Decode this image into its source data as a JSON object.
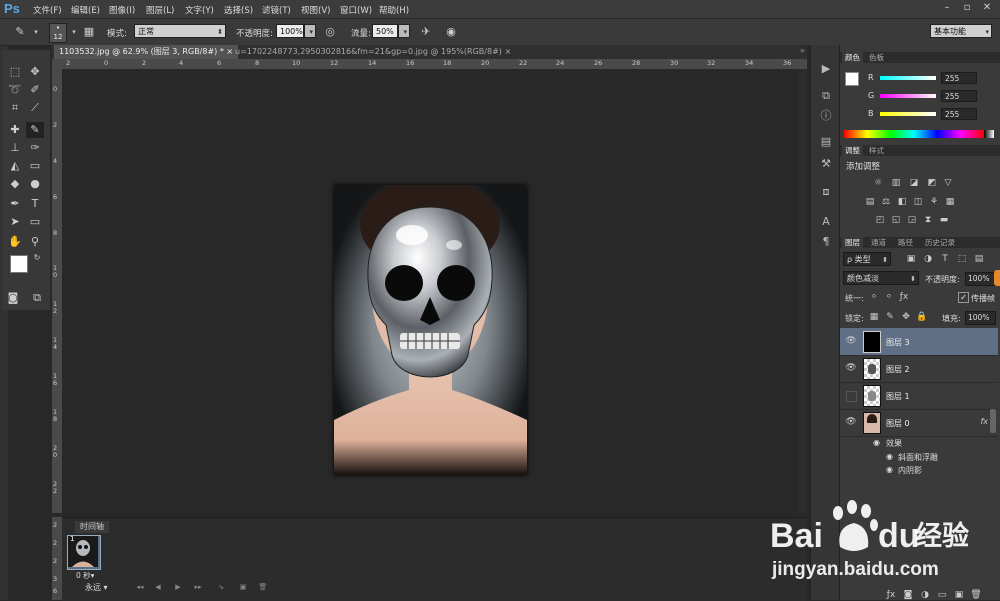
{
  "app": {
    "logo": "Ps"
  },
  "menu": [
    "文件(F)",
    "编辑(E)",
    "图像(I)",
    "图层(L)",
    "文字(Y)",
    "选择(S)",
    "滤镜(T)",
    "视图(V)",
    "窗口(W)",
    "帮助(H)"
  ],
  "options": {
    "brush_size": "12",
    "mode_label": "模式:",
    "mode_value": "正常",
    "opacity_label": "不透明度:",
    "opacity_value": "100%",
    "flow_label": "流量:",
    "flow_value": "50%",
    "workspace": "基本功能"
  },
  "tabs": [
    {
      "label": "1103532.jpg @ 62.9% (图层 3, RGB/8#) *",
      "close": "×"
    },
    {
      "label": "u=1702248773,2950302816&fm=21&gp=0.jpg @ 195%(RGB/8#)",
      "close": "×"
    }
  ],
  "ruler_top": [
    "2",
    "0",
    "2",
    "4",
    "6",
    "8",
    "10",
    "12",
    "14",
    "16",
    "18",
    "20",
    "22",
    "24",
    "26",
    "28",
    "30",
    "32",
    "34",
    "36"
  ],
  "ruler_left": [
    "0",
    "2",
    "4",
    "6",
    "8",
    "1 0",
    "1 2",
    "1 4",
    "1 6",
    "1 8",
    "2 0",
    "2 2",
    "2 4",
    "2 6",
    "2 8"
  ],
  "timeline": {
    "tab": "时间轴",
    "frame_number": "1",
    "frame_duration": "0 秒▾",
    "loop": "永远"
  },
  "color_panel": {
    "tabs": [
      "颜色",
      "色板"
    ],
    "channels": [
      {
        "label": "R",
        "value": "255"
      },
      {
        "label": "G",
        "value": "255"
      },
      {
        "label": "B",
        "value": "255"
      }
    ]
  },
  "adjust_panel": {
    "tabs": [
      "调整",
      "样式"
    ],
    "title": "添加调整"
  },
  "layers_panel": {
    "tabs": [
      "图层",
      "通道",
      "路径",
      "历史记录"
    ],
    "filter": "ρ 类型",
    "blend_mode": "颜色减淡",
    "opacity_label": "不透明度:",
    "opacity_value": "100%",
    "unify_label": "统一:",
    "propagate_label": "传播帧",
    "lock_label": "锁定:",
    "fill_label": "填充:",
    "fill_value": "100%",
    "layers": [
      {
        "name": "图层 3",
        "selected": true,
        "visible": true
      },
      {
        "name": "图层 2",
        "selected": false,
        "visible": true
      },
      {
        "name": "图层 1",
        "selected": false,
        "visible": false
      },
      {
        "name": "图层 0",
        "selected": false,
        "visible": true,
        "fx": "fx"
      }
    ],
    "effects_label": "效果",
    "effects": [
      "斜面和浮雕",
      "内阴影"
    ]
  },
  "watermark": {
    "brand": "Bai",
    "brand2": "du",
    "suffix": "经验",
    "url": "jingyan.baidu.com"
  },
  "colors": {
    "accent": "#5aa8e6",
    "selected_layer": "#5f6f85",
    "background": "#282828"
  }
}
